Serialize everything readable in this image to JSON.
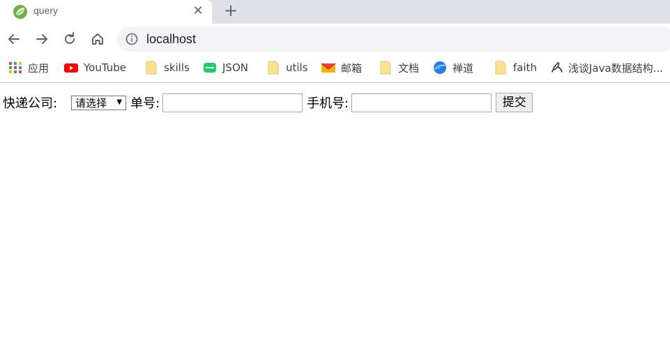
{
  "tab": {
    "title": "query",
    "close_glyph": "✕",
    "favicon": "spring-leaf-icon"
  },
  "new_tab_glyph": "+",
  "toolbar": {
    "url": "localhost"
  },
  "bookmarks": [
    {
      "label": "应用",
      "icon": "apps-grid-icon"
    },
    {
      "label": "YouTube",
      "icon": "youtube-icon"
    },
    {
      "label": "skills",
      "icon": "folder-icon"
    },
    {
      "label": "JSON",
      "icon": "json-icon"
    },
    {
      "label": "utils",
      "icon": "folder-icon"
    },
    {
      "label": "邮箱",
      "icon": "mail-icon"
    },
    {
      "label": "文档",
      "icon": "folder-icon"
    },
    {
      "label": "禅道",
      "icon": "globe-icon"
    },
    {
      "label": "faith",
      "icon": "folder-icon"
    },
    {
      "label": "浅谈Java数据结构...",
      "icon": "page-icon"
    }
  ],
  "form": {
    "company_label": "快递公司:",
    "company_select_value": "请选择",
    "number_label": "单号:",
    "number_value": "",
    "phone_label": "手机号:",
    "phone_value": "",
    "submit_label": "提交"
  },
  "colors": {
    "tabstrip": "#dee1e6",
    "omnibox": "#f1f3f4",
    "youtube_red": "#ff0000",
    "folder_yellow": "#fbe18d",
    "json_green": "#1dce6b"
  }
}
